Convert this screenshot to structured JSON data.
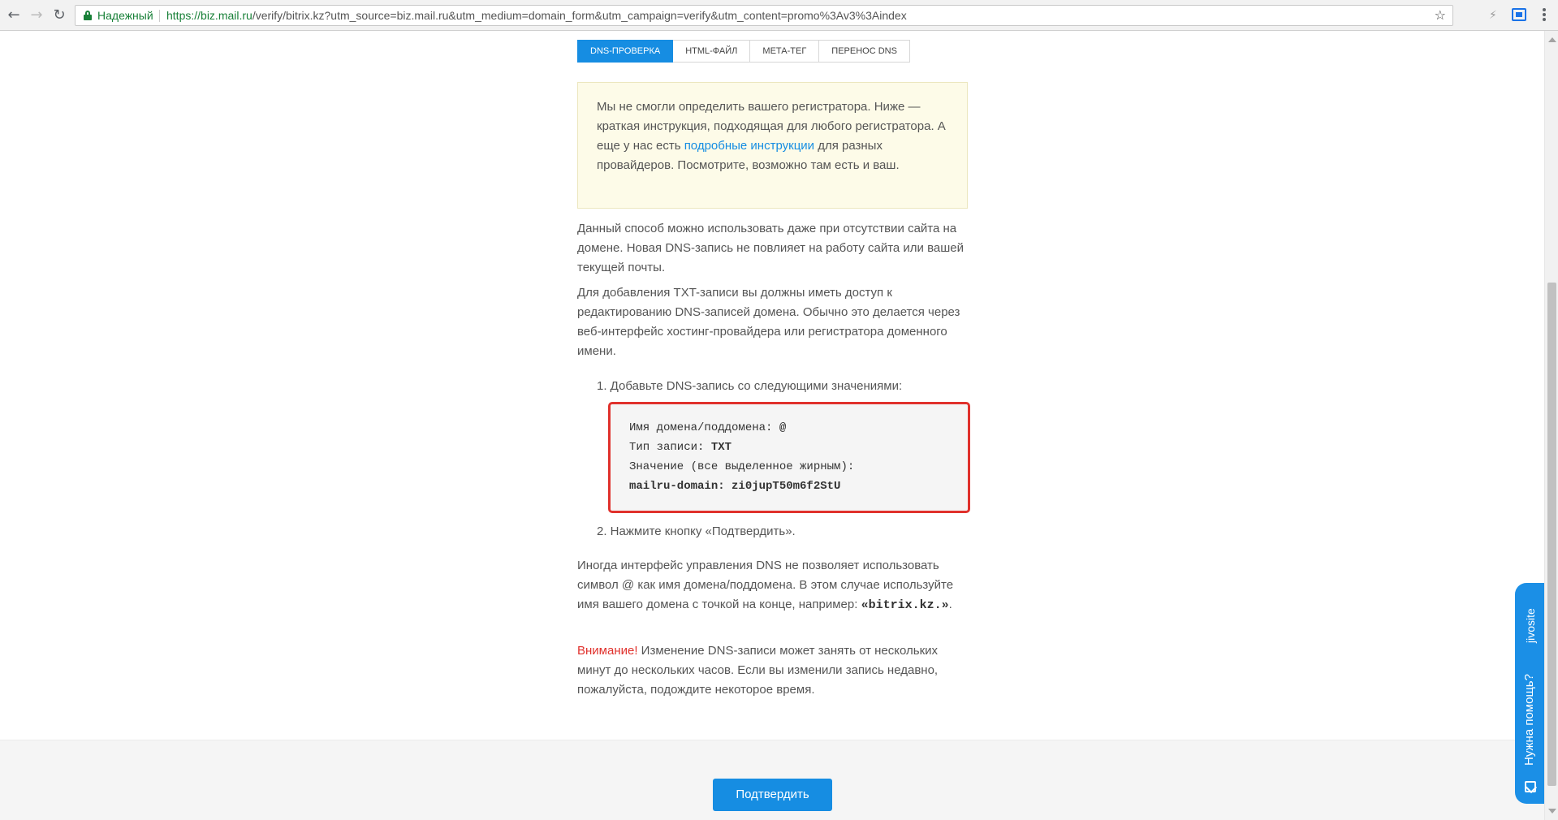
{
  "browser": {
    "secure_label": "Надежный",
    "url_scheme": "https://",
    "url_host": "biz.mail.ru",
    "url_rest": "/verify/bitrix.kz?utm_source=biz.mail.ru&utm_medium=domain_form&utm_campaign=verify&utm_content=promo%3Av3%3Aindex",
    "back_icon": "arrow-left-icon",
    "forward_icon": "arrow-right-icon",
    "reload_icon": "reload-icon",
    "bookmark_icon": "star-icon"
  },
  "tabs": [
    {
      "label": "DNS-проверка",
      "active": true
    },
    {
      "label": "HTML-файл",
      "active": false
    },
    {
      "label": "Мета-тег",
      "active": false
    },
    {
      "label": "Перенос DNS",
      "active": false
    }
  ],
  "notice": {
    "text_before": "Мы не смогли определить вашего регистратора. Ниже — краткая инструкция, подходящая для любого регистратора. А еще у нас есть ",
    "link": "подробные инструкции",
    "text_after": " для разных провайдеров. Посмотрите, возможно там есть и ваш."
  },
  "paragraphs": {
    "p1": "Данный способ можно использовать даже при отсутствии сайта на домене. Новая DNS-запись не повлияет на работу сайта или вашей текущей почты.",
    "p2": "Для добавления TXT-записи вы должны иметь доступ к редактированию DNS-записей домена. Обычно это делается через веб-интерфейс хостинг-провайдера или регистратора доменного имени."
  },
  "steps": {
    "step1": "1. Добавьте DNS-запись со следующими значениями:",
    "step2": "2. Нажмите кнопку «Подтвердить»."
  },
  "dns_record": {
    "name_label": "Имя домена/поддомена:",
    "name_value": "@",
    "type_label": "Тип записи:",
    "type_value": "TXT",
    "value_label": "Значение (все выделенное жирным):",
    "value": "mailru-domain: zi0jupT50m6f2StU"
  },
  "note": {
    "text": "Иногда интерфейс управления DNS не позволяет использовать символ @ как имя домена/поддомена. В этом случае используйте имя вашего домена с точкой на конце, например:",
    "example": "«bitrix.kz.»",
    "end": "."
  },
  "warning": {
    "label": "Внимание!",
    "text": " Изменение DNS-записи может занять от нескольких минут до нескольких часов. Если вы изменили запись недавно, пожалуйста, подождите некоторое время."
  },
  "confirm_button": "Подтвердить",
  "jivo": {
    "help_text": "Нужна помощь?",
    "brand": "jivosite"
  },
  "colors": {
    "accent": "#168de2",
    "warning": "#e0312c",
    "notice_bg": "#fdfbe8"
  }
}
